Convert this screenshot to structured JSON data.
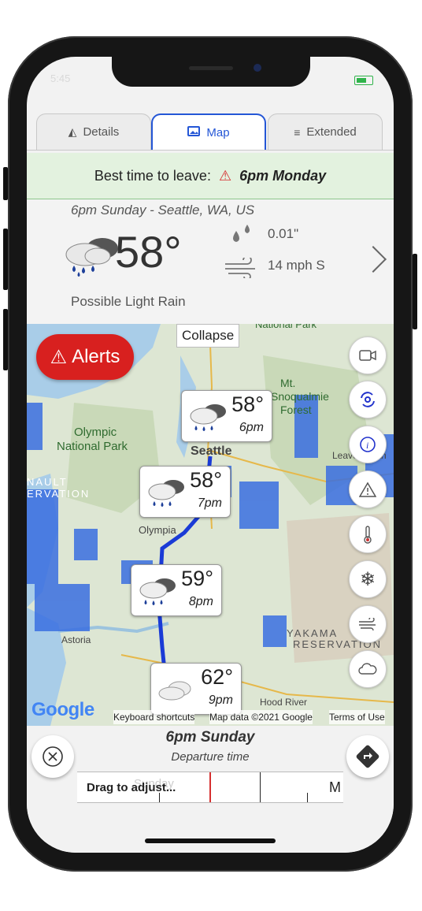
{
  "status": {
    "time": "5:45"
  },
  "tabs": [
    {
      "label": "Details",
      "icon": "road-icon"
    },
    {
      "label": "Map",
      "icon": "image-icon"
    },
    {
      "label": "Extended",
      "icon": "list-icon"
    }
  ],
  "best_time": {
    "prefix": "Best time to leave:",
    "value": "6pm Monday",
    "warning_color": "#d62f2f"
  },
  "current": {
    "when": "6pm Sunday - Seattle, WA, US",
    "temperature": "58°",
    "description": "Possible Light Rain",
    "precip": "0.01\"",
    "wind": "14 mph S"
  },
  "map": {
    "collapse_label": "Collapse",
    "alerts_label": "Alerts",
    "place_labels": [
      "Olympic",
      "National Park",
      "Seattle",
      "Olympia",
      "Astoria",
      "Mt.",
      "Snoqualmie",
      "Forest",
      "YAKAMA",
      "RESERVATION",
      "Hood River",
      "Leavenworth",
      "NAULT",
      "ERVATION",
      "National Park"
    ],
    "route_stops": [
      {
        "temp": "58°",
        "time": "6pm",
        "icon": "rain-cloud-icon"
      },
      {
        "temp": "58°",
        "time": "7pm",
        "icon": "rain-cloud-icon"
      },
      {
        "temp": "59°",
        "time": "8pm",
        "icon": "rain-cloud-icon"
      },
      {
        "temp": "62°",
        "time": "9pm",
        "icon": "cloud-icon"
      }
    ],
    "attribution": {
      "logo": "Google",
      "shortcuts": "Keyboard shortcuts",
      "data": "Map data ©2021 Google",
      "terms": "Terms of Use"
    },
    "layer_buttons": [
      "camera-icon",
      "hurricane-icon",
      "info-icon",
      "warning-icon",
      "thermometer-icon",
      "snowflake-icon",
      "wind-icon",
      "cloud-icon"
    ],
    "route_color": "#1a3bd6"
  },
  "departure": {
    "time": "6pm Sunday",
    "label": "Departure time",
    "slider_hint": "Drag to adjust...",
    "slider_ghost": "Sunday",
    "slider_next": "M"
  }
}
